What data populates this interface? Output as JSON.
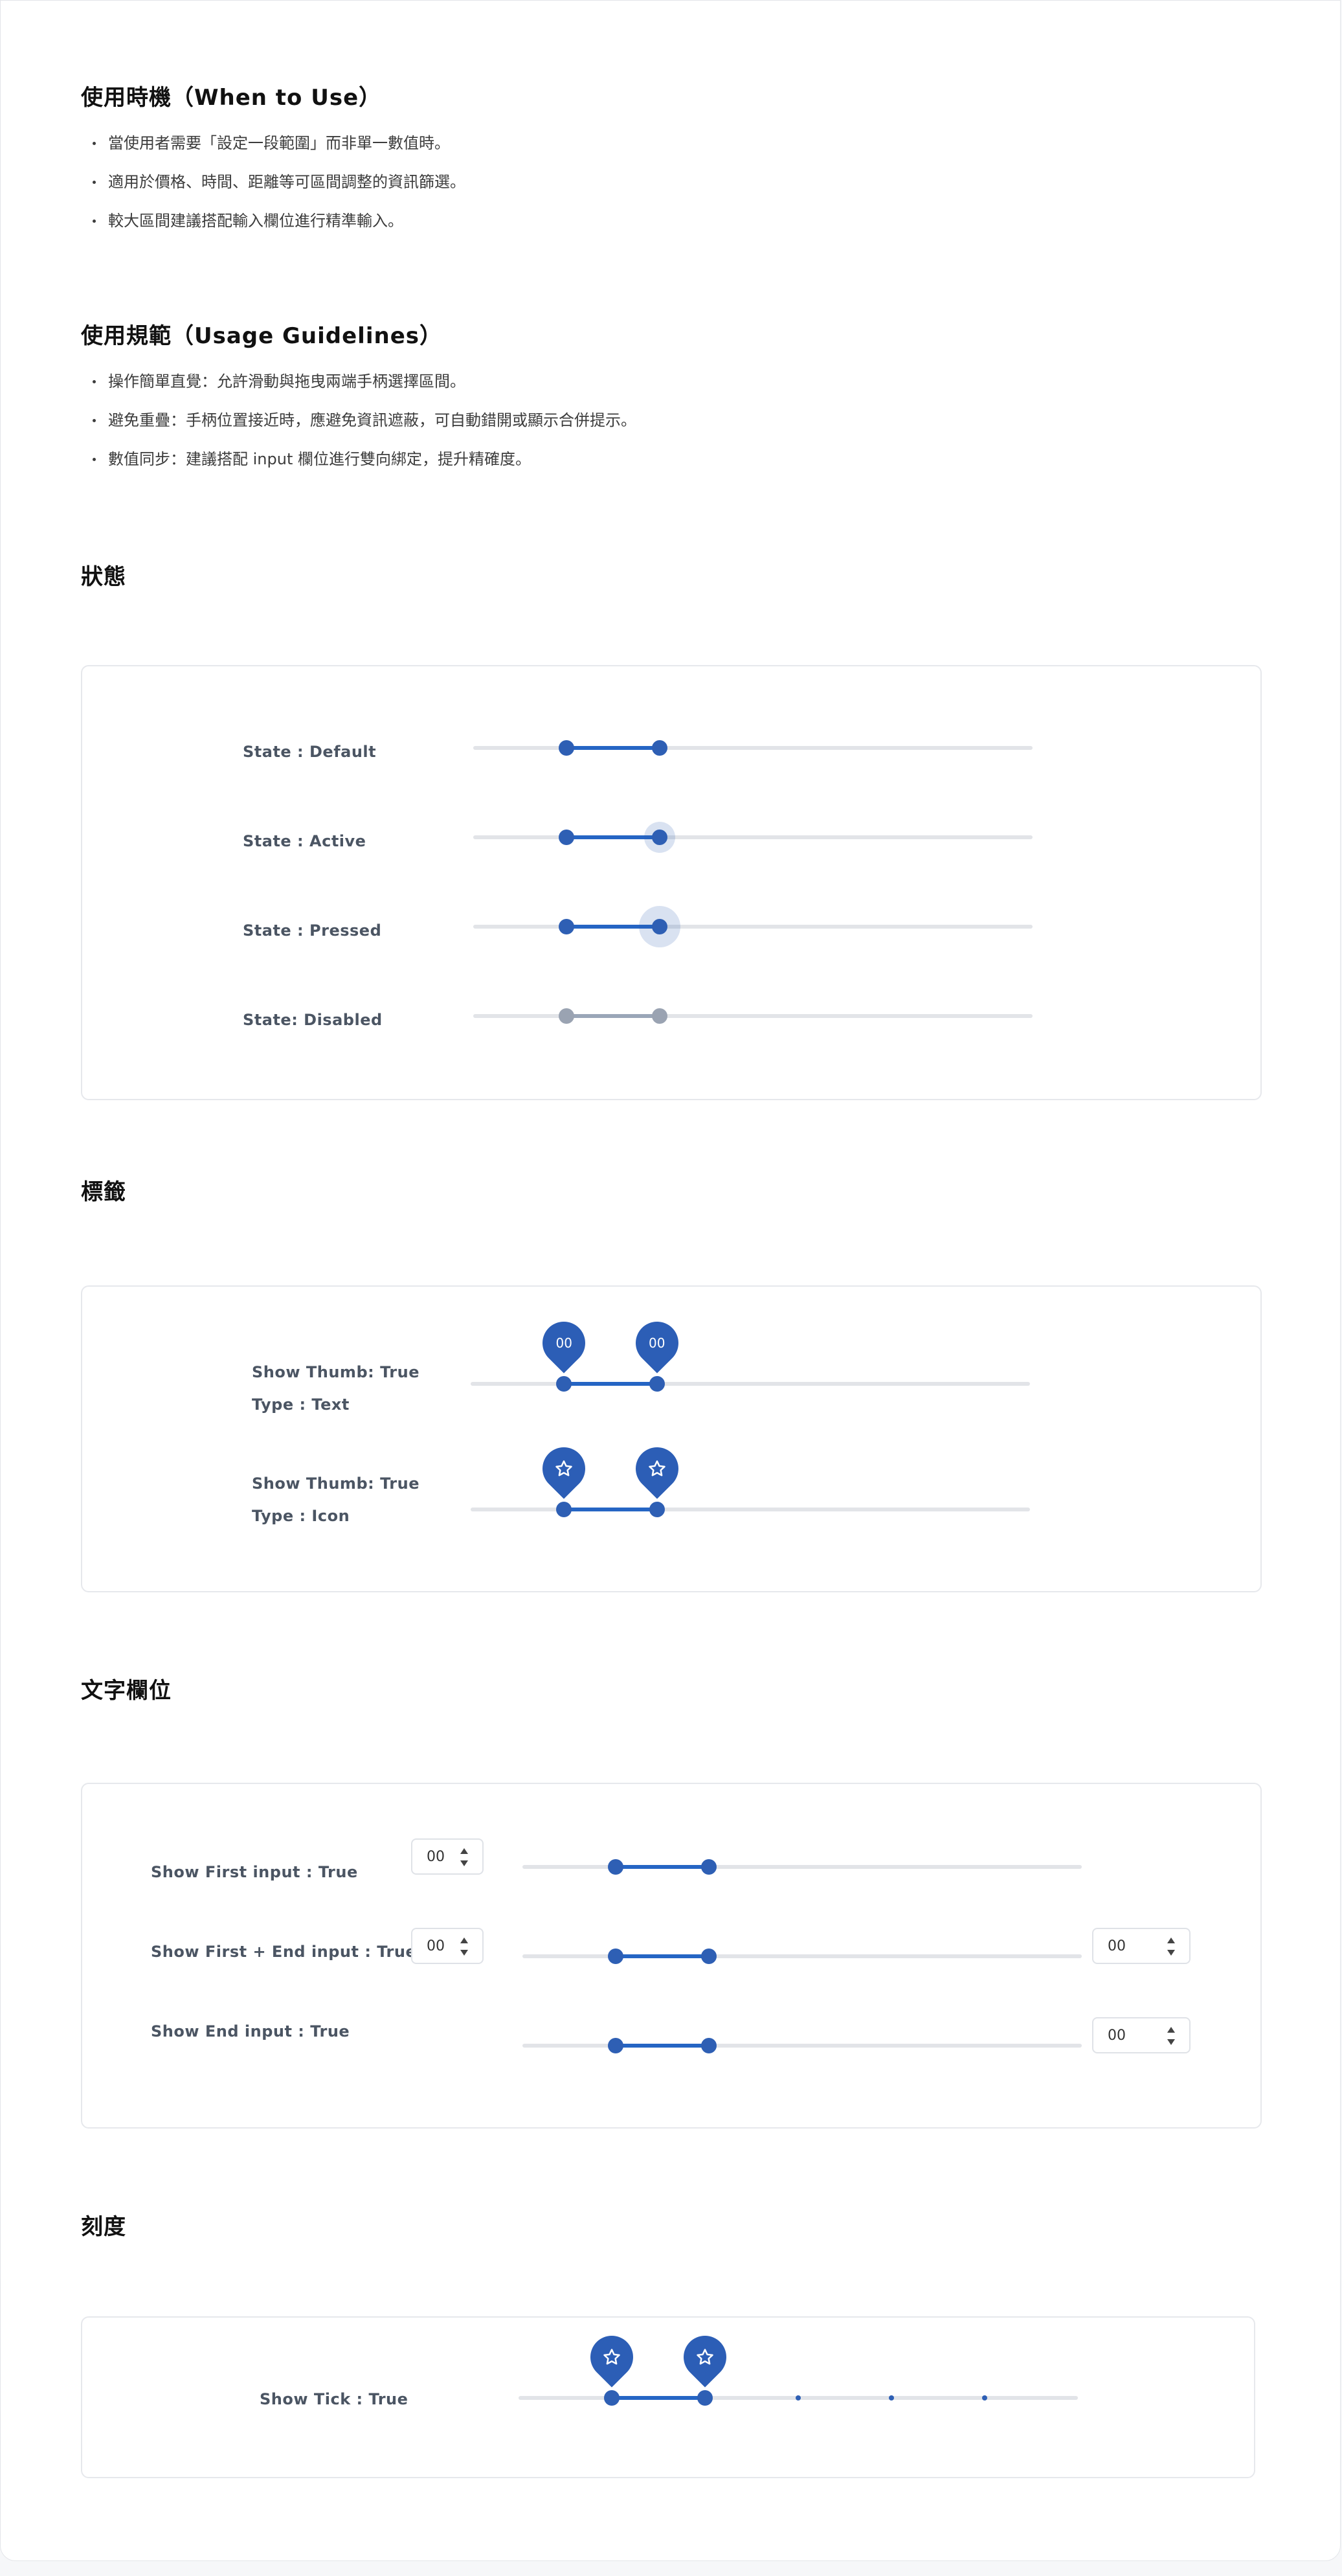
{
  "when_to_use": {
    "title": "使用時機（When to Use）",
    "items": [
      "當使用者需要「設定一段範圍」而非單一數值時。",
      "適用於價格、時間、距離等可區間調整的資訊篩選。",
      "較大區間建議搭配輸入欄位進行精準輸入。"
    ]
  },
  "usage_guidelines": {
    "title": "使用規範（Usage Guidelines）",
    "items": [
      "操作簡單直覺：允許滑動與拖曳兩端手柄選擇區間。",
      "避免重疊：手柄位置接近時，應避免資訊遮蔽，可自動錯開或顯示合併提示。",
      "數值同步：建議搭配 input 欄位進行雙向綁定，提升精確度。"
    ]
  },
  "states": {
    "title": "狀態",
    "rows": [
      {
        "label": "State : Default",
        "range": [
          0.167,
          0.333
        ]
      },
      {
        "label": "State : Active",
        "range": [
          0.167,
          0.333
        ]
      },
      {
        "label": "State : Pressed",
        "range": [
          0.167,
          0.333
        ]
      },
      {
        "label": "State: Disabled",
        "range": [
          0.167,
          0.333
        ]
      }
    ]
  },
  "labels": {
    "title": "標籤",
    "rows": [
      {
        "label_1": "Show Thumb: True",
        "label_2": "Type : Text",
        "thumb_text": "00",
        "range": [
          0.167,
          0.333
        ]
      },
      {
        "label_1": "Show Thumb: True",
        "label_2": "Type : Icon",
        "thumb_icon": "star-icon",
        "range": [
          0.167,
          0.333
        ]
      }
    ]
  },
  "text_fields": {
    "title": "文字欄位",
    "rows": [
      {
        "label": "Show First input : True",
        "first_value": "00",
        "range": [
          0.167,
          0.333
        ]
      },
      {
        "label": "Show First + End input : True",
        "first_value": "00",
        "end_value": "00",
        "range": [
          0.167,
          0.333
        ]
      },
      {
        "label": "Show End input : True",
        "end_value": "00",
        "range": [
          0.167,
          0.333
        ]
      }
    ]
  },
  "ticks": {
    "title": "刻度",
    "rows": [
      {
        "label": "Show Tick : True",
        "thumb_icon": "star-icon",
        "range": [
          0.167,
          0.333
        ],
        "tick_positions": [
          0.5,
          0.667,
          0.833
        ]
      }
    ]
  },
  "colors": {
    "accent": "#2e5fb4",
    "track": "#e2e4e8",
    "disabled": "#9aa3b2"
  }
}
